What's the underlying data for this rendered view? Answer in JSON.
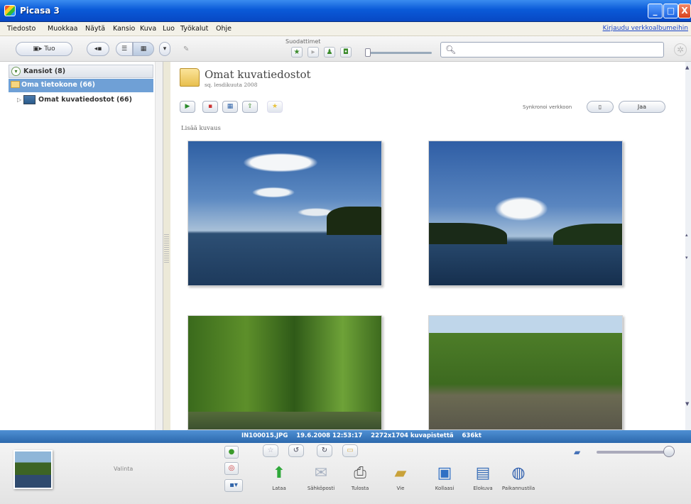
{
  "window": {
    "title": "Picasa 3",
    "minimize": "_",
    "maximize": "□",
    "close": "X"
  },
  "menu": {
    "items": [
      "Tiedosto",
      "Muokkaa",
      "Näytä",
      "Kansio",
      "Kuva",
      "Luo",
      "Työkalut",
      "Ohje"
    ],
    "signin": "Kirjaudu verkkoalbumeihin"
  },
  "toolbar": {
    "import_label": "Tuo",
    "filter_label": "Suodattimet",
    "search_placeholder": "",
    "search_icon": "magnifier-icon",
    "gear_icon": "gear-icon"
  },
  "sidebar": {
    "folders_header": "Kansiot (8)",
    "selected_item": "Oma tietokone (66)",
    "subitem": "Omat kuvatiedostot (66)"
  },
  "main": {
    "folder_title": "Omat kuvatiedostot",
    "folder_date": "sq. lesdikuuta 2008",
    "sync_label": "Synkronoi verkkoon",
    "share_label": "Jaa",
    "add_pictures": "Lisää kuvaus"
  },
  "status": {
    "filename": "IN100015.JPG",
    "datetime": "19.6.2008 12:53:17",
    "dimensions": "2272x1704 kuvapistettä",
    "size": "636kt"
  },
  "tray": {
    "selection_label": "Valinta",
    "actions": [
      {
        "label": "Lataa",
        "icon": "upload-arrow-icon"
      },
      {
        "label": "Sähköposti",
        "icon": "envelope-icon"
      },
      {
        "label": "Tulosta",
        "icon": "printer-icon"
      },
      {
        "label": "Vie",
        "icon": "folder-icon"
      },
      {
        "label": "Kollaasi",
        "icon": "collage-icon"
      },
      {
        "label": "Elokuva",
        "icon": "film-icon"
      },
      {
        "label": "Paikannustila",
        "icon": "globe-icon"
      }
    ]
  },
  "colors": {
    "titlebar": "#0a5ad8",
    "statusbar": "#3a7ac0",
    "selection": "#6fa0d6"
  }
}
